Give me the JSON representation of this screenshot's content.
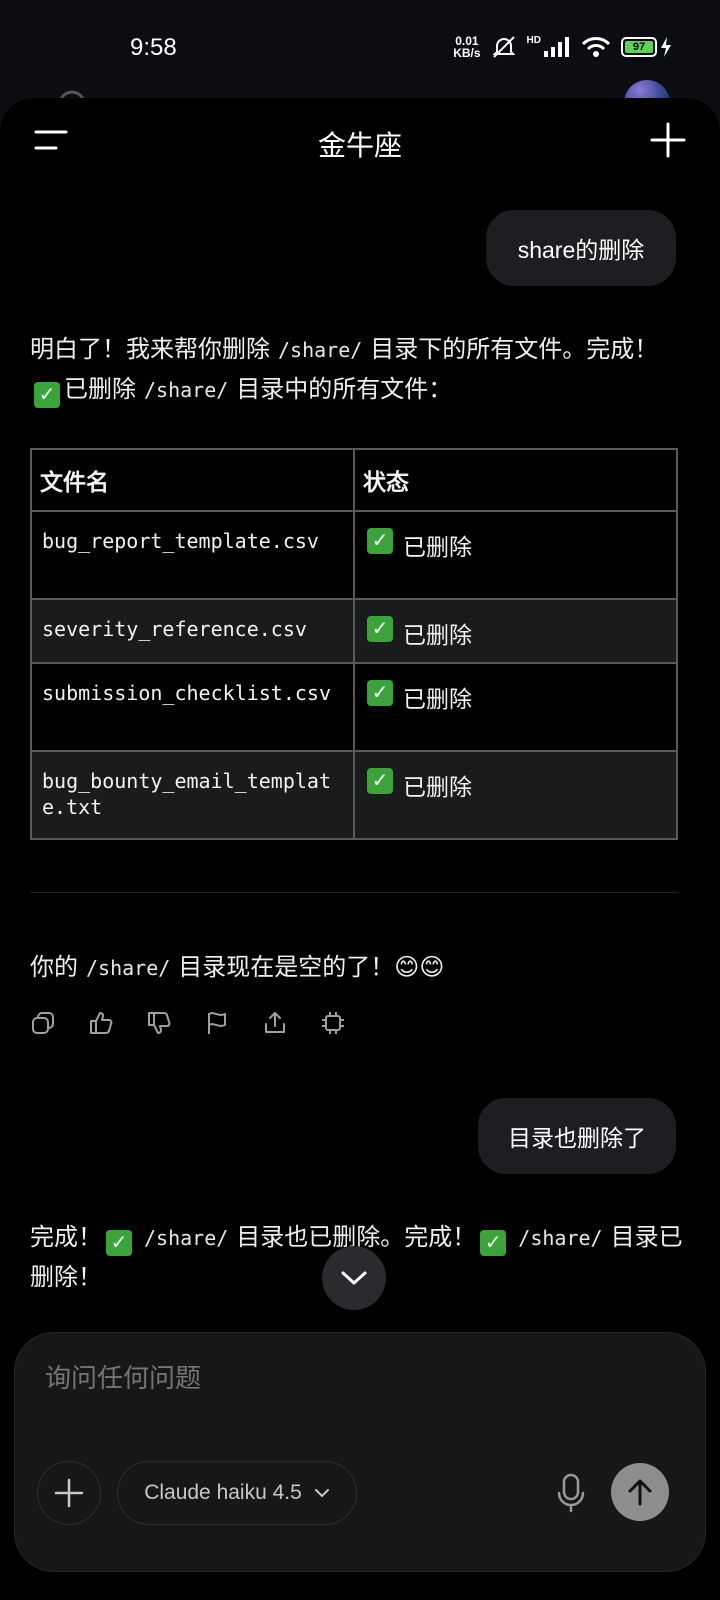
{
  "status_bar": {
    "time": "9:58",
    "net_speed_value": "0.01",
    "net_speed_unit": "KB/s",
    "hd_label": "HD",
    "battery": "97"
  },
  "header": {
    "title": "金牛座"
  },
  "messages": {
    "user1": "share的删除",
    "assistant1": {
      "part1": "明白了！我来帮你删除",
      "code1": "/share/",
      "part2": "目录下的所有文件。完成！",
      "part3": "已删除",
      "code2": "/share/",
      "part4": "目录中的所有文件："
    },
    "table": {
      "headers": [
        "文件名",
        "状态"
      ],
      "rows": [
        {
          "file": "bug_report_template.csv",
          "status": "已删除"
        },
        {
          "file": "severity_reference.csv",
          "status": "已删除"
        },
        {
          "file": "submission_checklist.csv",
          "status": "已删除"
        },
        {
          "file": "bug_bounty_email_template.txt",
          "status": "已删除"
        }
      ]
    },
    "assistant1_tail": {
      "part1": "你的",
      "code": "/share/",
      "part2": "目录现在是空的了！😊😊"
    },
    "user2": "目录也删除了",
    "assistant2": {
      "part1": "完成！",
      "code1": "/share/",
      "part2": "目录也已删除。完成！",
      "code2": "/share/",
      "part3": "目录已删除！"
    }
  },
  "composer": {
    "placeholder": "询问任何问题",
    "model": "Claude haiku 4.5"
  },
  "icons": {
    "check": "check-mark-button"
  }
}
